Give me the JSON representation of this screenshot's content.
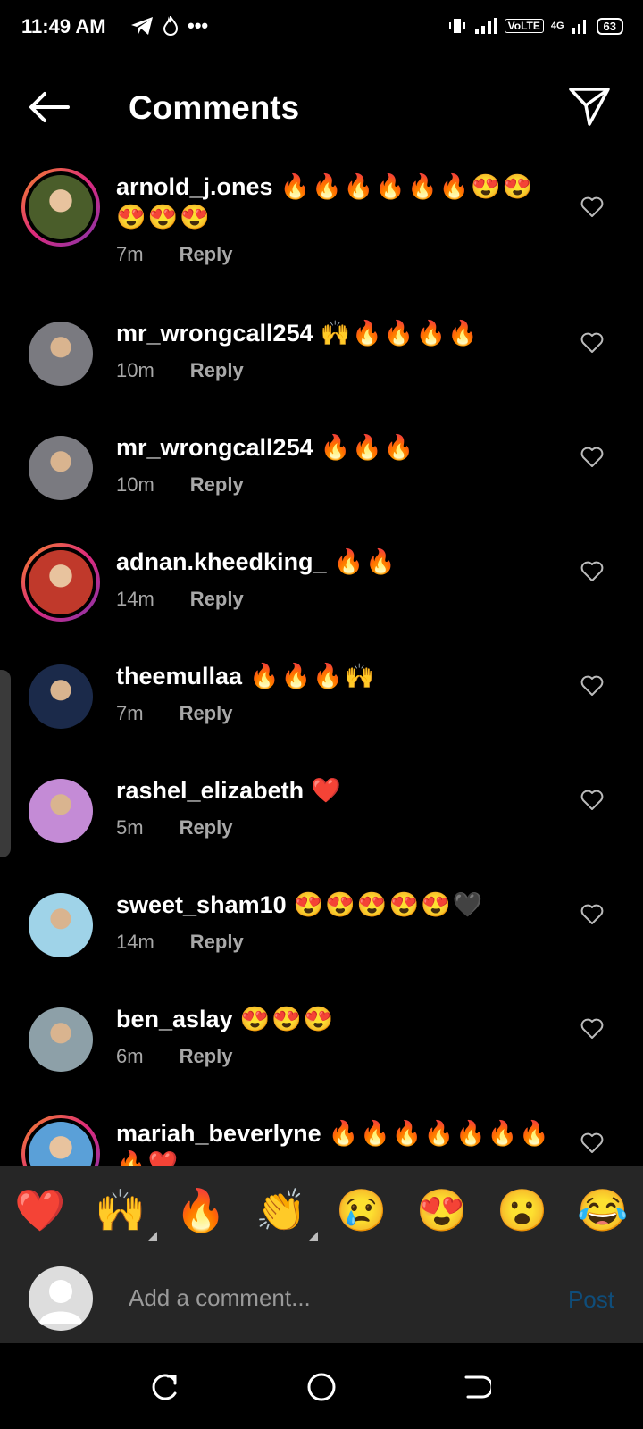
{
  "status_bar": {
    "time": "11:49 AM",
    "dots": "•••",
    "volte": "VoLTE",
    "network": "4G",
    "battery": "63"
  },
  "header": {
    "title": "Comments"
  },
  "comments": [
    {
      "user": "arnold_j.ones",
      "text": "🔥🔥🔥🔥🔥🔥😍😍😍😍😍",
      "time": "7m",
      "reply": "Reply",
      "story_ring": true,
      "avatar_color": "#4a5d2a"
    },
    {
      "user": "mr_wrongcall254",
      "text": "🙌🔥🔥🔥🔥",
      "time": "10m",
      "reply": "Reply",
      "story_ring": false,
      "avatar_color": "#7a7a80"
    },
    {
      "user": "mr_wrongcall254",
      "text": "🔥🔥🔥",
      "time": "10m",
      "reply": "Reply",
      "story_ring": false,
      "avatar_color": "#7a7a80"
    },
    {
      "user": "adnan.kheedking_",
      "text": "🔥🔥",
      "time": "14m",
      "reply": "Reply",
      "story_ring": true,
      "avatar_color": "#c0392b"
    },
    {
      "user": "theemullaa",
      "text": "🔥🔥🔥🙌",
      "time": "7m",
      "reply": "Reply",
      "story_ring": false,
      "avatar_color": "#1b2a4a"
    },
    {
      "user": "rashel_elizabeth",
      "text": "❤️",
      "time": "5m",
      "reply": "Reply",
      "story_ring": false,
      "avatar_color": "#c48bd6"
    },
    {
      "user": "sweet_sham10",
      "text": "😍😍😍😍😍🖤",
      "time": "14m",
      "reply": "Reply",
      "story_ring": false,
      "avatar_color": "#9fd3e8"
    },
    {
      "user": "ben_aslay",
      "text": "😍😍😍",
      "time": "6m",
      "reply": "Reply",
      "story_ring": false,
      "avatar_color": "#8da0a8"
    },
    {
      "user": "mariah_beverlyne",
      "text": "🔥🔥🔥🔥🔥🔥🔥🔥❤️",
      "time": "",
      "reply": "",
      "story_ring": true,
      "avatar_color": "#5aa0d8"
    }
  ],
  "emoji_bar": [
    "❤️",
    "🙌",
    "🔥",
    "👏",
    "😢",
    "😍",
    "😮",
    "😂"
  ],
  "input": {
    "placeholder": "Add a comment...",
    "post_label": "Post"
  }
}
